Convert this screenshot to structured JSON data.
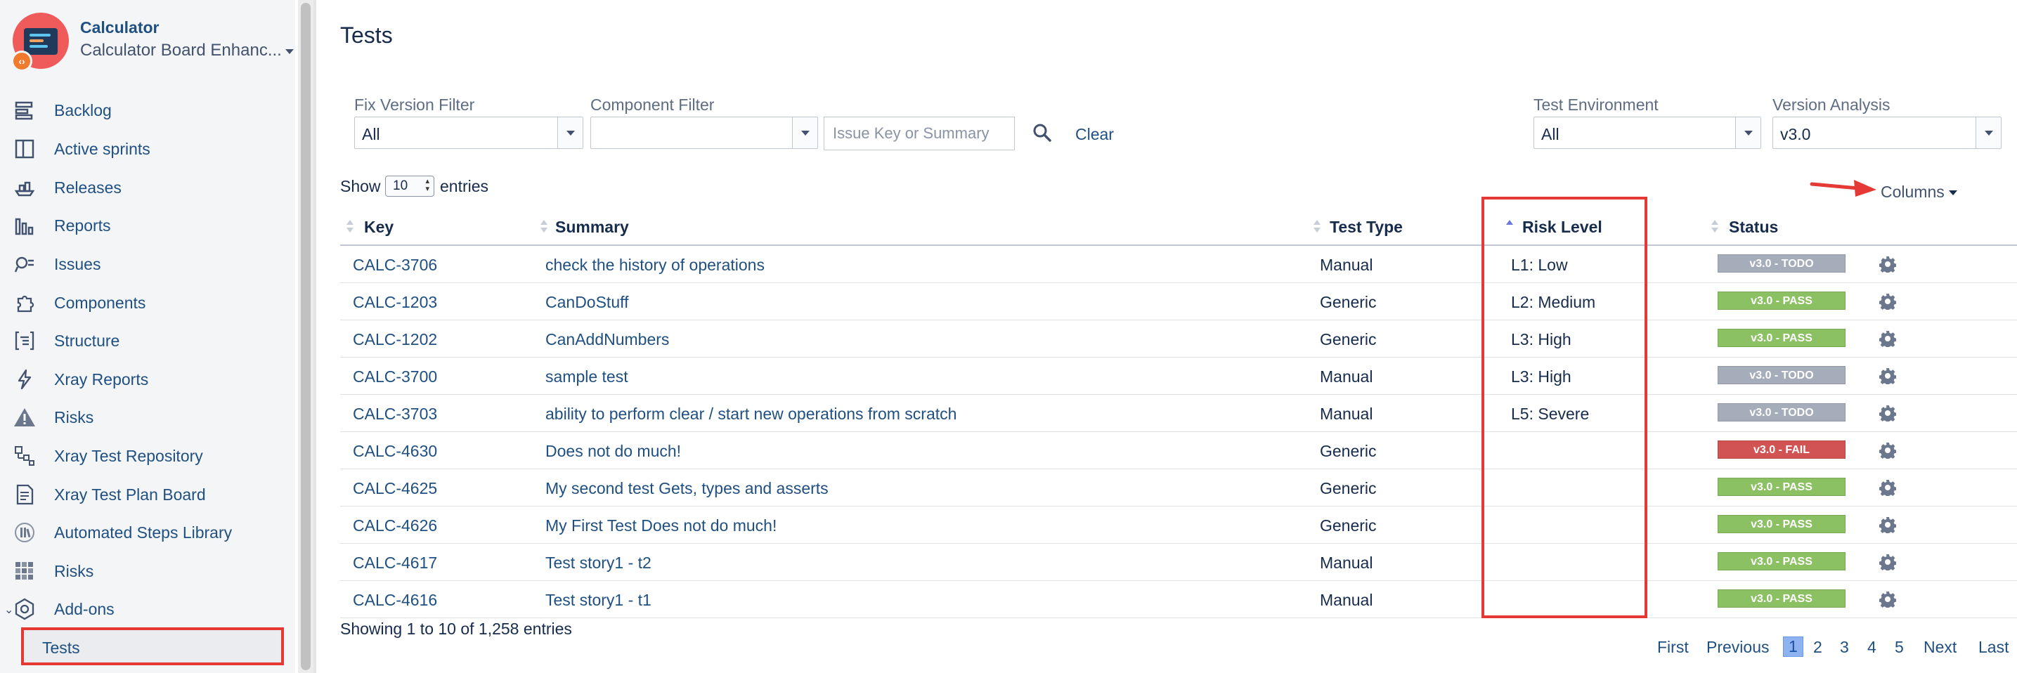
{
  "sidebar": {
    "project_name": "Calculator",
    "board_name": "Calculator Board Enhanc...",
    "items": [
      {
        "label": "Backlog",
        "icon": "backlog-icon"
      },
      {
        "label": "Active sprints",
        "icon": "board-icon"
      },
      {
        "label": "Releases",
        "icon": "ship-icon"
      },
      {
        "label": "Reports",
        "icon": "chart-icon"
      },
      {
        "label": "Issues",
        "icon": "search-issues-icon"
      },
      {
        "label": "Components",
        "icon": "puzzle-icon"
      },
      {
        "label": "Structure",
        "icon": "structure-icon"
      },
      {
        "label": "Xray Reports",
        "icon": "lightning-icon"
      },
      {
        "label": "Risks",
        "icon": "warning-icon"
      },
      {
        "label": "Xray Test Repository",
        "icon": "repository-icon"
      },
      {
        "label": "Xray Test Plan Board",
        "icon": "document-icon"
      },
      {
        "label": "Automated Steps Library",
        "icon": "library-icon"
      },
      {
        "label": "Risks",
        "icon": "grid-icon"
      },
      {
        "label": "Add-ons",
        "icon": "addons-icon"
      }
    ],
    "selected_sub_item": "Tests"
  },
  "page": {
    "title": "Tests"
  },
  "filters": {
    "fix_version_label": "Fix Version Filter",
    "fix_version_value": "All",
    "component_label": "Component Filter",
    "component_value": "",
    "search_placeholder": "Issue Key or Summary",
    "clear_label": "Clear",
    "test_env_label": "Test Environment",
    "test_env_value": "All",
    "version_analysis_label": "Version Analysis",
    "version_analysis_value": "v3.0"
  },
  "table_controls": {
    "show_label": "Show",
    "entries_value": "10",
    "entries_label": "entries",
    "columns_label": "Columns"
  },
  "table": {
    "headers": {
      "key": "Key",
      "summary": "Summary",
      "test_type": "Test Type",
      "risk_level": "Risk Level",
      "status": "Status"
    },
    "rows": [
      {
        "key": "CALC-3706",
        "summary": "check the history of operations",
        "test_type": "Manual",
        "risk": "L1: Low",
        "status": "v3.0 - TODO",
        "status_color": "#a5adba"
      },
      {
        "key": "CALC-1203",
        "summary": "CanDoStuff",
        "test_type": "Generic",
        "risk": "L2: Medium",
        "status": "v3.0 - PASS",
        "status_color": "#8bc063"
      },
      {
        "key": "CALC-1202",
        "summary": "CanAddNumbers",
        "test_type": "Generic",
        "risk": "L3: High",
        "status": "v3.0 - PASS",
        "status_color": "#8bc063"
      },
      {
        "key": "CALC-3700",
        "summary": "sample test",
        "test_type": "Manual",
        "risk": "L3: High",
        "status": "v3.0 - TODO",
        "status_color": "#a5adba"
      },
      {
        "key": "CALC-3703",
        "summary": "ability to perform clear / start new operations from scratch",
        "test_type": "Manual",
        "risk": "L5: Severe",
        "status": "v3.0 - TODO",
        "status_color": "#a5adba"
      },
      {
        "key": "CALC-4630",
        "summary": "Does not do much!",
        "test_type": "Generic",
        "risk": "",
        "status": "v3.0 - FAIL",
        "status_color": "#d25353"
      },
      {
        "key": "CALC-4625",
        "summary": "My second test Gets, types and asserts",
        "test_type": "Generic",
        "risk": "",
        "status": "v3.0 - PASS",
        "status_color": "#8bc063"
      },
      {
        "key": "CALC-4626",
        "summary": "My First Test Does not do much!",
        "test_type": "Generic",
        "risk": "",
        "status": "v3.0 - PASS",
        "status_color": "#8bc063"
      },
      {
        "key": "CALC-4617",
        "summary": "Test story1 - t2",
        "test_type": "Manual",
        "risk": "",
        "status": "v3.0 - PASS",
        "status_color": "#8bc063"
      },
      {
        "key": "CALC-4616",
        "summary": "Test story1 - t1",
        "test_type": "Manual",
        "risk": "",
        "status": "v3.0 - PASS",
        "status_color": "#8bc063"
      }
    ],
    "showing_text": "Showing 1 to 10 of 1,258 entries"
  },
  "pagination": {
    "first": "First",
    "previous": "Previous",
    "pages": [
      "1",
      "2",
      "3",
      "4",
      "5"
    ],
    "current_page": "1",
    "next": "Next",
    "last": "Last"
  },
  "colors": {
    "link": "#205081",
    "highlight": "#e53935",
    "pass": "#8bc063",
    "todo": "#a5adba",
    "fail": "#d25353"
  }
}
